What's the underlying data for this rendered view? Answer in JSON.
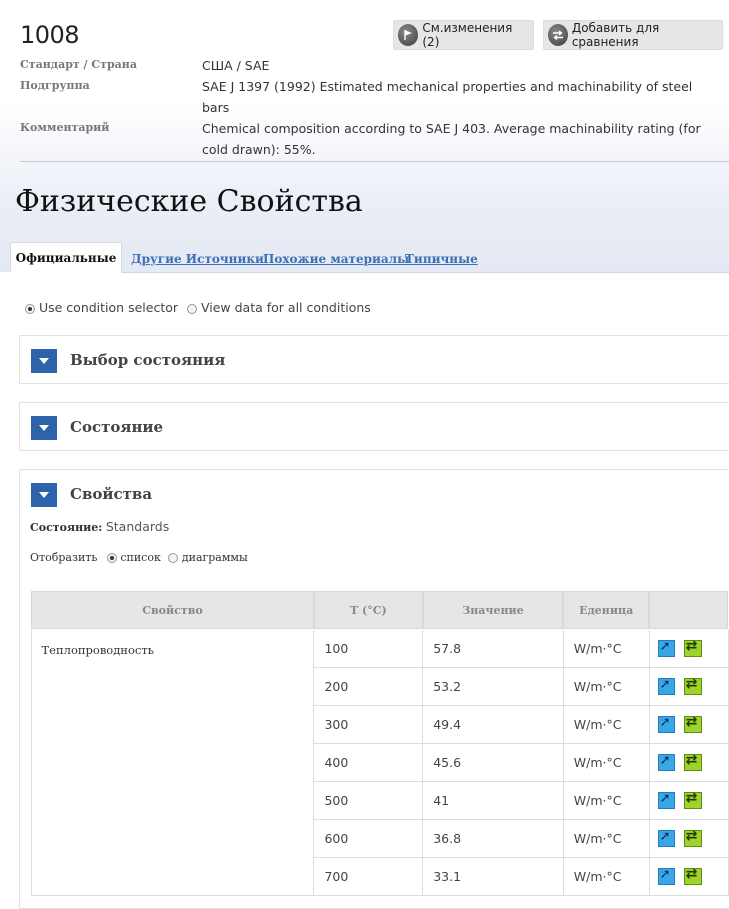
{
  "material": {
    "id": "1008",
    "buttons": {
      "changes_label": "См.изменения (2)",
      "compare_label": "Добавить для сравнения"
    },
    "meta": [
      {
        "label": "Стандарт / Страна",
        "value": "США / SAE"
      },
      {
        "label": "Подгруппа",
        "value": "SAE J 1397 (1992) Estimated mechanical properties and machinability of steel bars"
      },
      {
        "label": "Комментарий",
        "value": "Chemical composition according to SAE J 403. Average machinability rating (for cold drawn): 55%."
      }
    ]
  },
  "page_title": "Физические Свойства",
  "tabs": [
    {
      "label": "Официальные",
      "active": true
    },
    {
      "label": "Другие Источники",
      "active": false
    },
    {
      "label": "Похожие материалы",
      "active": false
    },
    {
      "label": "Типичные",
      "active": false
    }
  ],
  "condition_mode": {
    "options": [
      "Use condition selector",
      "View data for all conditions"
    ],
    "selected": "Use condition selector"
  },
  "panels": {
    "selector_title": "Выбор состояния",
    "state_title": "Состояние",
    "properties_title": "Свойства"
  },
  "properties": {
    "state_label": "Состояние:",
    "state_value": "Standards",
    "display_label": "Отобразить",
    "display_options": [
      "список",
      "диаграммы"
    ],
    "display_selected": "список",
    "table": {
      "headers": [
        "Свойство",
        "T (°C)",
        "Значение",
        "Еденица",
        ""
      ],
      "property_name": "Теплопроводность",
      "rows": [
        {
          "t": "100",
          "value": "57.8",
          "unit": "W/m·°C"
        },
        {
          "t": "200",
          "value": "53.2",
          "unit": "W/m·°C"
        },
        {
          "t": "300",
          "value": "49.4",
          "unit": "W/m·°C"
        },
        {
          "t": "400",
          "value": "45.6",
          "unit": "W/m·°C"
        },
        {
          "t": "500",
          "value": "41",
          "unit": "W/m·°C"
        },
        {
          "t": "600",
          "value": "36.8",
          "unit": "W/m·°C"
        },
        {
          "t": "700",
          "value": "33.1",
          "unit": "W/m·°C"
        }
      ]
    }
  },
  "colors": {
    "accent": "#2d63a8",
    "link": "#3c6fb5",
    "action_blue": "#39a7e6",
    "action_green": "#9fd22a"
  }
}
